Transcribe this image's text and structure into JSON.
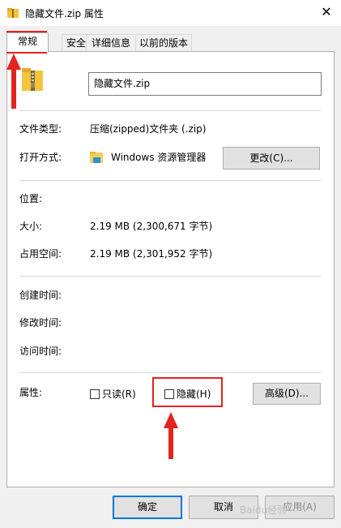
{
  "window": {
    "title": "隐藏文件.zip 属性",
    "close_glyph": "✕"
  },
  "tabs": [
    {
      "label": "常规"
    },
    {
      "label": "安全"
    },
    {
      "label": "详细信息"
    },
    {
      "label": "以前的版本"
    }
  ],
  "general": {
    "file_name": "隐藏文件.zip",
    "file_type_label": "文件类型:",
    "file_type_value": "压缩(zipped)文件夹 (.zip)",
    "open_with_label": "打开方式:",
    "open_with_value": "Windows 资源管理器",
    "change_button": "更改(C)...",
    "location_label": "位置:",
    "size_label": "大小:",
    "size_value": "2.19 MB (2,300,671 字节)",
    "size_on_disk_label": "占用空间:",
    "size_on_disk_value": "2.19 MB (2,301,952 字节)",
    "created_label": "创建时间:",
    "modified_label": "修改时间:",
    "accessed_label": "访问时间:",
    "attributes_label": "属性:",
    "readonly_label": "只读(R)",
    "hidden_label": "隐藏(H)",
    "advanced_button": "高级(D)..."
  },
  "footer": {
    "ok_button": "确定",
    "cancel_button": "取消",
    "apply_button": "应用(A)"
  },
  "annotation_color": "#e3231f",
  "watermark": "Baidu经验"
}
